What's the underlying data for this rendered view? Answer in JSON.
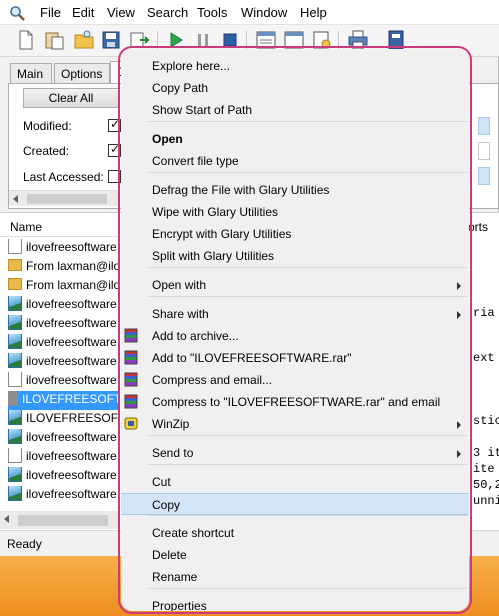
{
  "menubar": {
    "items": [
      "File",
      "Edit",
      "View",
      "Search",
      "Tools",
      "Window",
      "Help"
    ]
  },
  "tabs": [
    "Main",
    "Options",
    "D"
  ],
  "filter_panel": {
    "clear_all": "Clear All",
    "rows": [
      {
        "label": "Modified:",
        "checked": true
      },
      {
        "label": "Created:",
        "checked": true
      },
      {
        "label": "Last Accessed:",
        "checked": false
      }
    ]
  },
  "list": {
    "header": "Name",
    "rows": [
      {
        "name": "ilovefreesoftware",
        "icon": "document-icon"
      },
      {
        "name": "From laxman@ilo",
        "icon": "folder-icon"
      },
      {
        "name": "From laxman@ilo",
        "icon": "folder-icon"
      },
      {
        "name": "ilovefreesoftware",
        "icon": "image-icon"
      },
      {
        "name": "ilovefreesoftware",
        "icon": "image-icon"
      },
      {
        "name": "ilovefreesoftware",
        "icon": "image-icon"
      },
      {
        "name": "ilovefreesoftware",
        "icon": "image-icon"
      },
      {
        "name": "ilovefreesoftware",
        "icon": "document-icon"
      },
      {
        "name": "ILOVEFREESOFTV",
        "icon": "file-icon",
        "selected": true
      },
      {
        "name": "ILOVEFREESOFTV",
        "icon": "image-icon"
      },
      {
        "name": "ilovefreesoftware",
        "icon": "image-icon"
      },
      {
        "name": "ilovefreesoftware",
        "icon": "document-icon"
      },
      {
        "name": "ilovefreesoftware",
        "icon": "image-icon"
      },
      {
        "name": "ilovefreesoftware",
        "icon": "image-icon"
      }
    ]
  },
  "right_fragments": {
    "reports": "orts",
    "t1": "ria",
    "t2": "ext",
    "t3": "stic",
    "t4": "3 it",
    "t5": "ite",
    "t6": "50,2",
    "t7": "unni"
  },
  "status": "Ready",
  "context_menu": {
    "items": [
      {
        "label": "Explore here...",
        "bold": false,
        "submenu": false
      },
      {
        "label": "Copy Path",
        "bold": false,
        "submenu": false
      },
      {
        "label": "Show Start of Path",
        "bold": false,
        "submenu": false
      },
      {
        "label": "Open",
        "bold": true,
        "submenu": false
      },
      {
        "label": "Convert file type",
        "bold": false,
        "submenu": false
      },
      {
        "label": "Defrag the File with Glary Utilities",
        "bold": false,
        "submenu": false
      },
      {
        "label": "Wipe with Glary Utilities",
        "bold": false,
        "submenu": false
      },
      {
        "label": "Encrypt with Glary Utilities",
        "bold": false,
        "submenu": false
      },
      {
        "label": "Split with Glary Utilities",
        "bold": false,
        "submenu": false
      },
      {
        "label": "Open with",
        "bold": false,
        "submenu": true
      },
      {
        "label": "Share with",
        "bold": false,
        "submenu": true
      },
      {
        "label": "Add to archive...",
        "bold": false,
        "submenu": false,
        "icon": "winrar-icon"
      },
      {
        "label": "Add to \"ILOVEFREESOFTWARE.rar\"",
        "bold": false,
        "submenu": false,
        "icon": "winrar-icon"
      },
      {
        "label": "Compress and email...",
        "bold": false,
        "submenu": false,
        "icon": "winrar-icon"
      },
      {
        "label": "Compress to \"ILOVEFREESOFTWARE.rar\" and email",
        "bold": false,
        "submenu": false,
        "icon": "winrar-icon"
      },
      {
        "label": "WinZip",
        "bold": false,
        "submenu": true,
        "icon": "winzip-icon"
      },
      {
        "label": "Send to",
        "bold": false,
        "submenu": true
      },
      {
        "label": "Cut",
        "bold": false,
        "submenu": false
      },
      {
        "label": "Copy",
        "bold": false,
        "submenu": false,
        "highlighted": true
      },
      {
        "label": "Create shortcut",
        "bold": false,
        "submenu": false
      },
      {
        "label": "Delete",
        "bold": false,
        "submenu": false
      },
      {
        "label": "Rename",
        "bold": false,
        "submenu": false
      },
      {
        "label": "Properties",
        "bold": false,
        "submenu": false
      }
    ]
  },
  "colors": {
    "highlight_outline": "#cc3a7e",
    "selection": "#3399ff",
    "menu_hover": "#d4e5f7"
  }
}
